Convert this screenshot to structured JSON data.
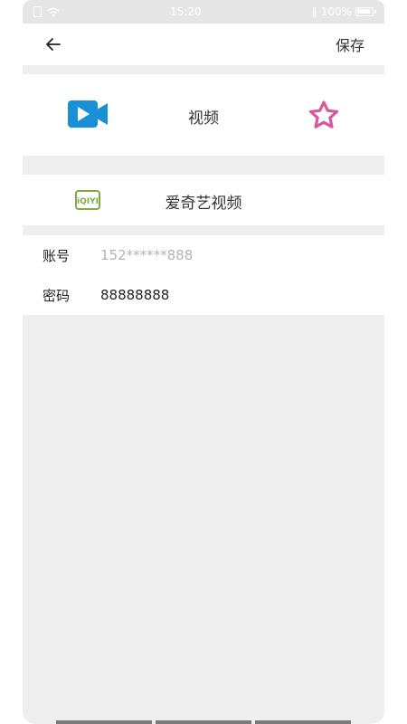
{
  "statusbar": {
    "time": "15:20",
    "battery": "100%"
  },
  "header": {
    "save_label": "保存"
  },
  "category": {
    "label": "视频",
    "icon_color": "#1b8fd6",
    "star_color": "#d9579b"
  },
  "app": {
    "name": "爱奇艺视频",
    "logo_text": "iQIYI",
    "logo_color": "#7fad3d"
  },
  "credentials": {
    "account_label": "账号",
    "account_placeholder": "152******888",
    "password_label": "密码",
    "password_value": "88888888"
  }
}
